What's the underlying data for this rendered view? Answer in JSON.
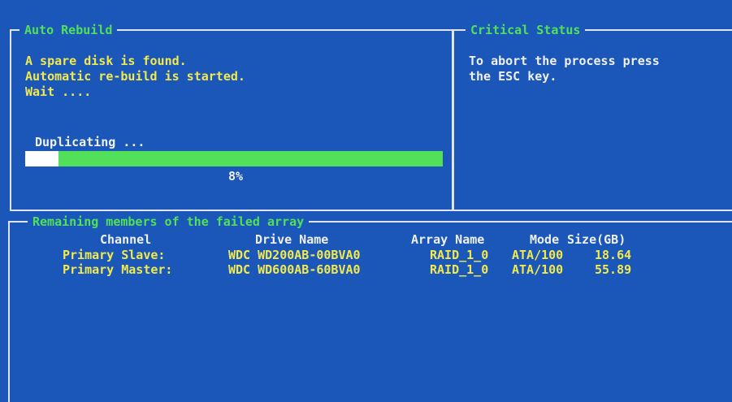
{
  "auto_rebuild": {
    "title": "Auto Rebuild",
    "lines": [
      "A spare disk is found.",
      "Automatic re-build is started.",
      "Wait ...."
    ],
    "progress_label": "Duplicating ...",
    "progress_fraction": 0.08,
    "progress_text": "8%"
  },
  "critical_status": {
    "title": "Critical Status",
    "lines": [
      "To abort the process press",
      "the ESC key."
    ]
  },
  "remaining": {
    "title": "Remaining members of the failed array",
    "headers": [
      "Channel",
      "Drive Name",
      "Array Name",
      "Mode",
      "Size(GB)"
    ],
    "rows": [
      [
        "Primary Slave:",
        "WDC WD200AB-00BVA0",
        "RAID_1_0",
        "ATA/100",
        "18.64"
      ],
      [
        "Primary Master:",
        "WDC WD600AB-60BVA0",
        "RAID_1_0",
        "ATA/100",
        "55.89"
      ]
    ]
  },
  "colors": {
    "background": "#1a57b8",
    "title": "#52e05a",
    "text": "#f2e94e",
    "header": "#f0f0f0",
    "progress_bar": "#52e05a"
  }
}
